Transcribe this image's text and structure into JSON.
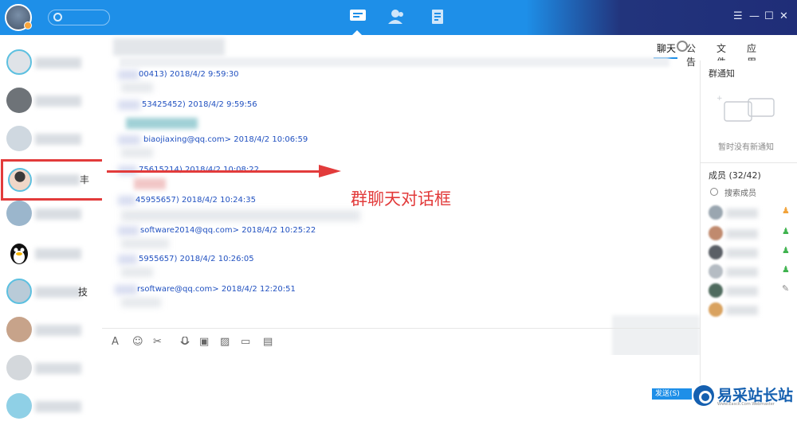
{
  "window": {
    "controls": [
      "☰",
      "—",
      "☐",
      "✕"
    ]
  },
  "nav": {
    "icons": [
      "chat-icon",
      "contacts-icon",
      "notes-icon"
    ]
  },
  "chat": {
    "tabs": [
      "聊天",
      "公告",
      "文件",
      "应用"
    ],
    "messages": [
      {
        "id": "00413)",
        "time": "2018/4/2 9:59:30"
      },
      {
        "id": "53425452)",
        "time": "2018/4/2 9:59:56"
      },
      {
        "id": "biaojiaxing@qq.com>",
        "time": "2018/4/2 10:06:59"
      },
      {
        "id": "75615214)",
        "time": "2018/4/2 10:08:22"
      },
      {
        "id": "45955657)",
        "time": "2018/4/2 10:24:35"
      },
      {
        "id": "software2014@qq.com>",
        "time": "2018/4/2 10:25:22"
      },
      {
        "id": "5955657)",
        "time": "2018/4/2 10:26:05"
      },
      {
        "id": "rsoftware@qq.com>",
        "time": "2018/4/2 12:20:51"
      }
    ],
    "toolbar": [
      "A",
      "☺",
      "✂",
      "🎤",
      "▣",
      "▨",
      "▭",
      "▤"
    ],
    "send_label": "发送(S)"
  },
  "sidebar": {
    "highlight_suffix": "丰",
    "row7_suffix": "技"
  },
  "annotation": {
    "text": "群聊天对话框"
  },
  "right_panel": {
    "notice_title": "群通知",
    "notice_empty": "暂时没有新通知",
    "members_title": "成员 (32/42)",
    "search_placeholder": "搜索成员"
  },
  "watermark": {
    "text": "易采站长站",
    "sub": "Www.Easck.Com Webmaster"
  },
  "colors": {
    "topbar": "#1e8fe8",
    "accent_red": "#e23b3b",
    "link_blue": "#2151c0"
  }
}
